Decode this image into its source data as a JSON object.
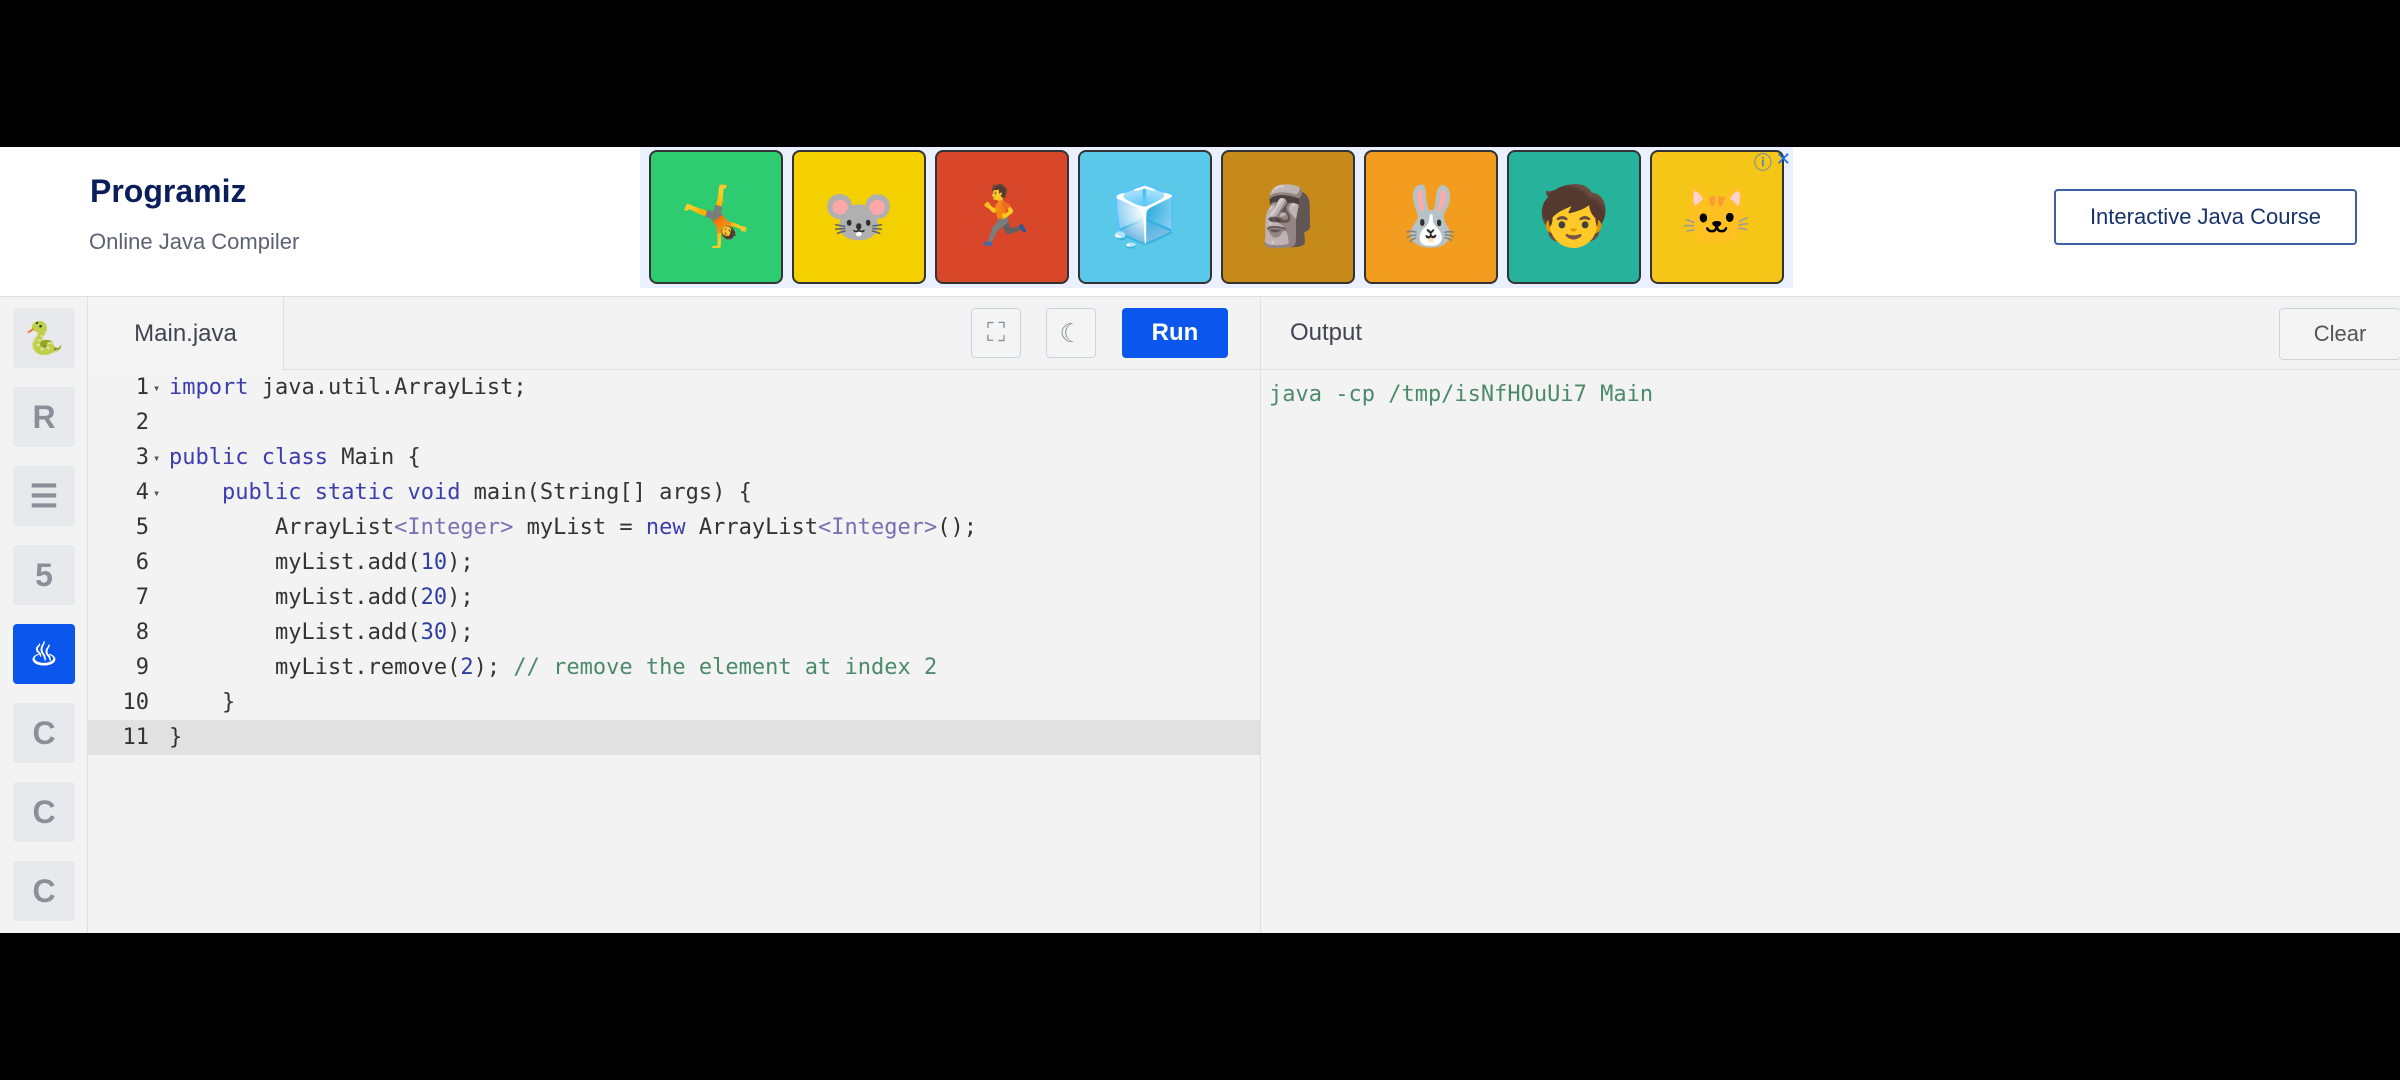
{
  "header": {
    "logo": "Programiz",
    "subtitle": "Online Java Compiler",
    "course_button": "Interactive Java Course",
    "ad_tiles": [
      "🤸",
      "🐭",
      "🏃",
      "🧊",
      "🗿",
      "🐰",
      "🧒",
      "🐱"
    ]
  },
  "sidebar": {
    "items": [
      {
        "name": "python",
        "glyph": "🐍"
      },
      {
        "name": "r",
        "glyph": "R"
      },
      {
        "name": "sql",
        "glyph": "☰"
      },
      {
        "name": "html",
        "glyph": "5"
      },
      {
        "name": "java",
        "glyph": "♨"
      },
      {
        "name": "c",
        "glyph": "C"
      },
      {
        "name": "csharp",
        "glyph": "C"
      },
      {
        "name": "cpp",
        "glyph": "C"
      }
    ],
    "active": "java"
  },
  "editor": {
    "file_tab": "Main.java",
    "run_label": "Run",
    "fullscreen_icon": "⛶",
    "theme_icon": "☾",
    "active_line": 11,
    "lines": [
      "import java.util.ArrayList;",
      "",
      "public class Main {",
      "    public static void main(String[] args) {",
      "        ArrayList<Integer> myList = new ArrayList<Integer>();",
      "        myList.add(10);",
      "        myList.add(20);",
      "        myList.add(30);",
      "        myList.remove(2); // remove the element at index 2",
      "    }",
      "}"
    ]
  },
  "output": {
    "title": "Output",
    "clear_label": "Clear",
    "text": "java -cp /tmp/isNfHOuUi7 Main"
  }
}
